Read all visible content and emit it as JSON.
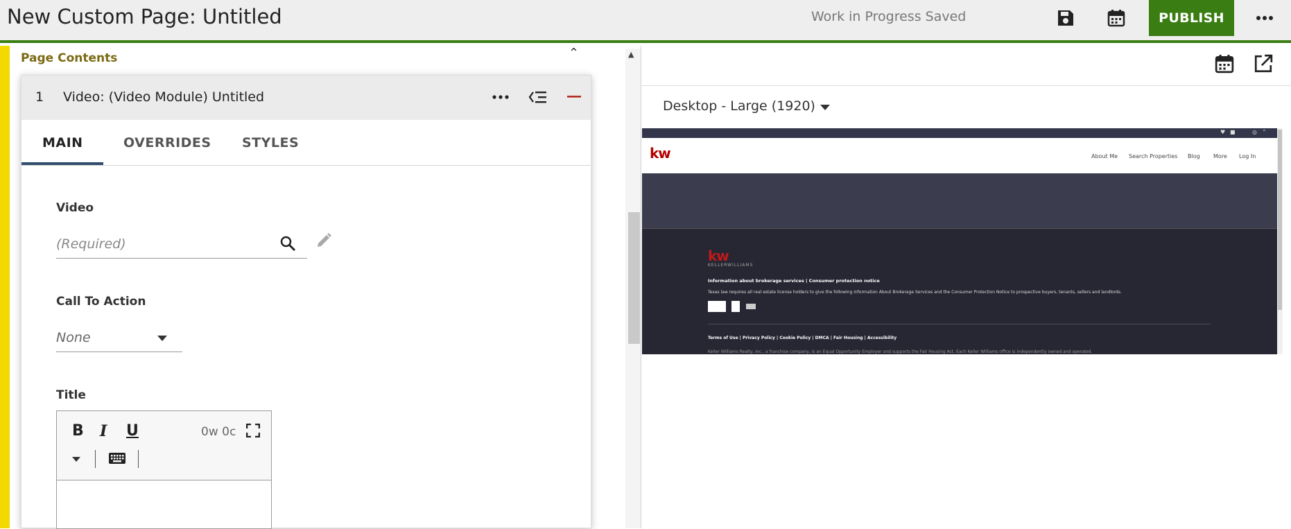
{
  "header": {
    "title": "New Custom Page: Untitled",
    "status": "Work in Progress Saved",
    "icons": [
      "eye-icon",
      "save-icon",
      "calendar-icon",
      "more-icon"
    ],
    "publish_label": "PUBLISH",
    "colors": {
      "accent": "#3a7d12",
      "rail": "#f2d900"
    }
  },
  "editor": {
    "section_title": "Page Contents",
    "module": {
      "index": "1",
      "name": "Video: (Video Module) Untitled"
    },
    "tabs": [
      {
        "label": "MAIN"
      },
      {
        "label": "OVERRIDES"
      },
      {
        "label": "STYLES"
      }
    ],
    "fields": {
      "video_label": "Video",
      "video_placeholder": "(Required)",
      "cta_label": "Call To Action",
      "cta_value": "None",
      "title_label": "Title",
      "title_counter": "0w 0c"
    }
  },
  "preview": {
    "device": "Desktop - Large (1920)",
    "site": {
      "logo": "kw",
      "nav": [
        "About Me",
        "Search Properties",
        "Blog",
        "More",
        "Log In"
      ],
      "footer_logo": "kw",
      "footer_logo_sub": "KELLERWILLIAMS",
      "footer_heading": "Information about brokerage services  |  Consumer protection notice",
      "footer_text": "Texas law requires all real estate license holders to give the following information About Brokerage Services and the Consumer Protection Notice to prospective buyers, tenants, sellers and landlords.",
      "footer_links": "Terms of Use | Privacy Policy | Cookie Policy | DMCA | Fair Housing | Accessibility",
      "footer_tiny": "Keller Williams Realty, Inc., a franchise company, is an Equal Opportunity Employer and supports the Fair Housing Act. Each Keller Williams office is independently owned and operated."
    }
  }
}
